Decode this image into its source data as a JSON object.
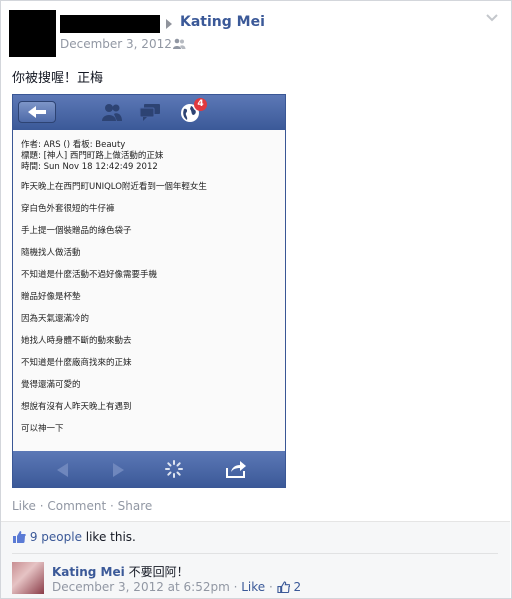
{
  "post": {
    "author": "Kating Mei",
    "date": "December 3, 2012",
    "status": "你被搜喔！正梅"
  },
  "screenshot": {
    "notification_count": "4",
    "lines": [
      "作者: ARS () 看板: Beauty",
      "標題: [神人] 西門町路上做活動的正妹",
      "時間: Sun Nov 18 12:42:49 2012",
      "昨天晚上在西門町UNIQLO附近看到一個年輕女生",
      "穿白色外套很短的牛仔褲",
      "手上提一個裝贈品的綠色袋子",
      "隨機找人做活動",
      "不知道是什麼活動不過好像需要手機",
      "贈品好像是杯墊",
      "因為天氣還滿冷的",
      "她找人時身體不斷的動來動去",
      "不知道是什麼廠商找來的正妹",
      "覺得還滿可愛的",
      "想說有沒有人昨天晚上有遇到",
      "可以神一下"
    ]
  },
  "actions": {
    "like": "Like",
    "dot1": " · ",
    "comment": "Comment",
    "dot2": " · ",
    "share": "Share"
  },
  "likes": {
    "count": "9 people",
    "suffix": " like this."
  },
  "comment": {
    "author": "Kating Mei",
    "text": " 不要回阿！",
    "timestamp": "December 3, 2012 at 6:52pm",
    "dot": " · ",
    "like_label": "Like",
    "dot2": " · ",
    "like_count": "2"
  },
  "colors": {
    "link": "#3b5998",
    "meta": "#9197a3"
  }
}
